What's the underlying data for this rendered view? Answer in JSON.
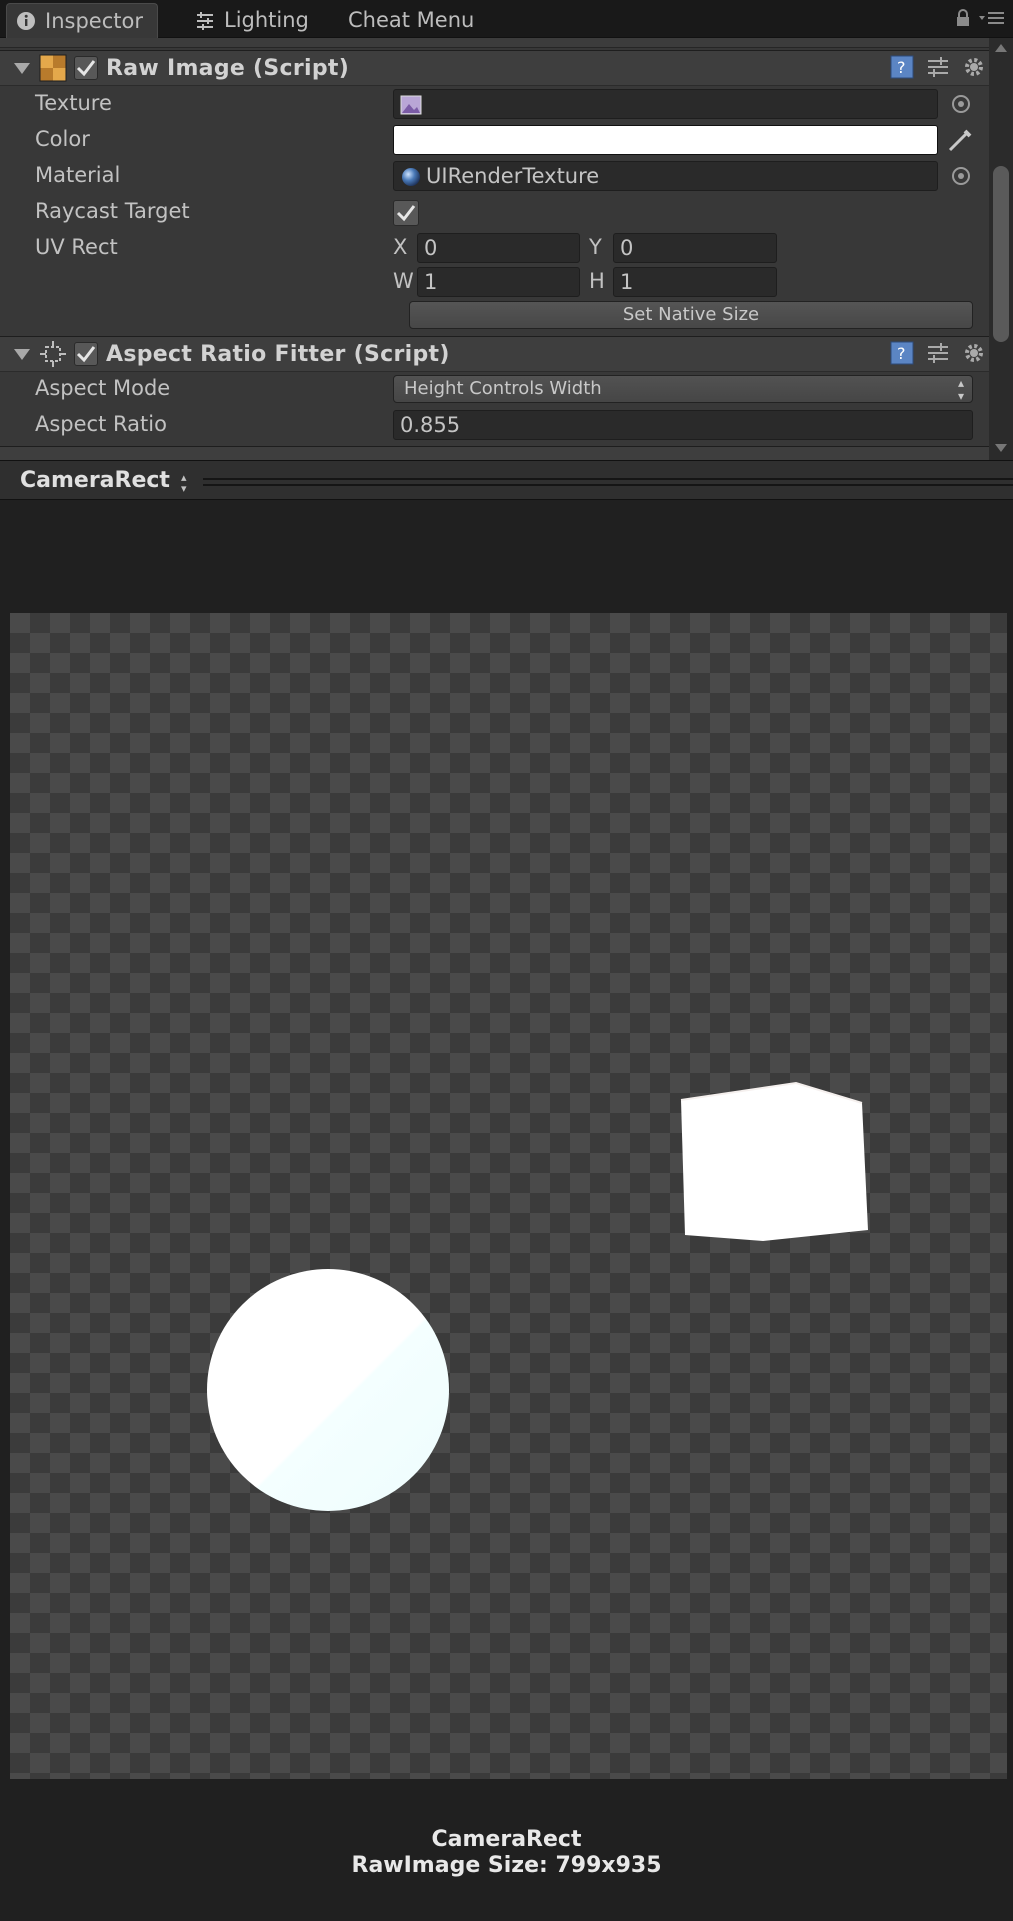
{
  "tabs": [
    {
      "label": "Inspector",
      "icon": "info-icon",
      "active": true
    },
    {
      "label": "Lighting",
      "icon": "lighting-sliders-icon",
      "active": false
    },
    {
      "label": "Cheat Menu",
      "icon": "",
      "active": false
    }
  ],
  "inspector": {
    "raw_image": {
      "title": "Raw Image (Script)",
      "enabled": true,
      "texture_label": "Texture",
      "color_label": "Color",
      "color_value": "#ffffff",
      "material_label": "Material",
      "material_value": "UIRenderTexture",
      "raycast_label": "Raycast Target",
      "raycast_checked": true,
      "uvrect_label": "UV Rect",
      "uv": {
        "x_label": "X",
        "x": "0",
        "y_label": "Y",
        "y": "0",
        "w_label": "W",
        "w": "1",
        "h_label": "H",
        "h": "1"
      },
      "set_native_size": "Set Native Size"
    },
    "aspect_ratio_fitter": {
      "title": "Aspect Ratio Fitter (Script)",
      "enabled": true,
      "aspect_mode_label": "Aspect Mode",
      "aspect_mode_value": "Height Controls Width",
      "aspect_ratio_label": "Aspect Ratio",
      "aspect_ratio_value": "0.855"
    }
  },
  "preview": {
    "title": "CameraRect",
    "caption_name": "CameraRect",
    "caption_size": "RawImage Size: 799x935"
  },
  "colors": {
    "panel": "#383838",
    "background": "#202020",
    "checker_light": "#4a4a4a",
    "checker_dark": "#3b3b3b"
  }
}
